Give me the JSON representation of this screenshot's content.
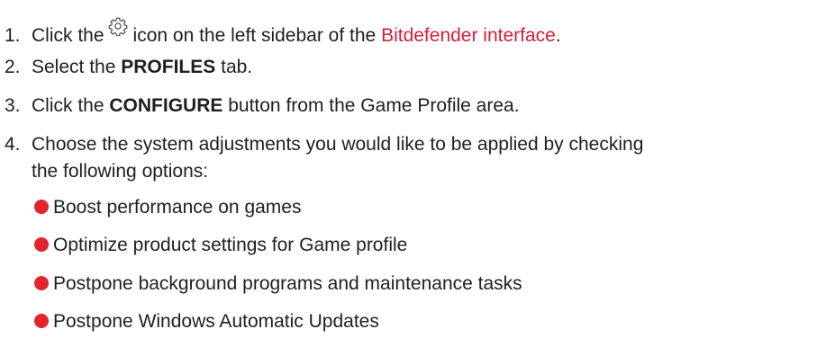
{
  "steps": [
    {
      "num": "1.",
      "pre": "Click the",
      "icon": "gear-icon",
      "mid": "icon on the left sidebar of the",
      "link": "Bitdefender interface",
      "post": "."
    },
    {
      "num": "2.",
      "pre": "Select the",
      "bold": "PROFILES",
      "post": "tab."
    },
    {
      "num": "3.",
      "pre": "Click the",
      "bold": "CONFIGURE",
      "post": "button from the Game Profile area."
    },
    {
      "num": "4.",
      "line1": "Choose the system adjustments you would like to be applied by checking",
      "line2": "the following options:"
    }
  ],
  "options": [
    "Boost performance on games",
    "Optimize product settings for Game profile",
    "Postpone background programs and maintenance tasks",
    "Postpone Windows Automatic Updates"
  ],
  "colors": {
    "accent": "#e3242e",
    "link": "#d4203b",
    "text": "#1f1f1f"
  }
}
